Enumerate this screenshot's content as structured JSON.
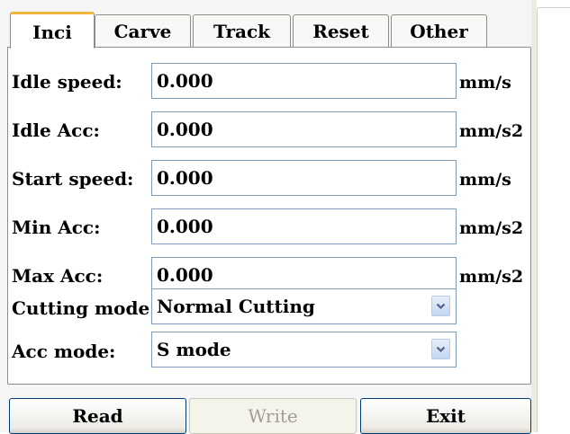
{
  "tabs": [
    {
      "label": "Inci",
      "active": true
    },
    {
      "label": "Carve",
      "active": false
    },
    {
      "label": "Track",
      "active": false
    },
    {
      "label": "Reset",
      "active": false
    },
    {
      "label": "Other",
      "active": false
    }
  ],
  "fields": {
    "idle_speed": {
      "label": "Idle speed:",
      "value": "0.000",
      "unit": "mm/s"
    },
    "idle_acc": {
      "label": "Idle Acc:",
      "value": "0.000",
      "unit": "mm/s2"
    },
    "start_speed": {
      "label": "Start speed:",
      "value": "0.000",
      "unit": "mm/s"
    },
    "min_acc": {
      "label": "Min Acc:",
      "value": "0.000",
      "unit": "mm/s2"
    },
    "max_acc": {
      "label": "Max Acc:",
      "value": "0.000",
      "unit": "mm/s2"
    }
  },
  "selects": {
    "cutting_mode": {
      "label": "Cutting mode:",
      "value": "Normal Cutting"
    },
    "acc_mode": {
      "label": "Acc mode:",
      "value": "S mode"
    }
  },
  "buttons": {
    "read": "Read",
    "write": "Write",
    "exit": "Exit"
  },
  "colors": {
    "active_tab_accent": "#f0b441",
    "field_border": "#7f9db9",
    "dropdown_arrow": "#4d6185",
    "button_border": "#003c74",
    "disabled_text": "#a19f95"
  },
  "icons": {
    "dropdown": "chevron-down-icon"
  }
}
